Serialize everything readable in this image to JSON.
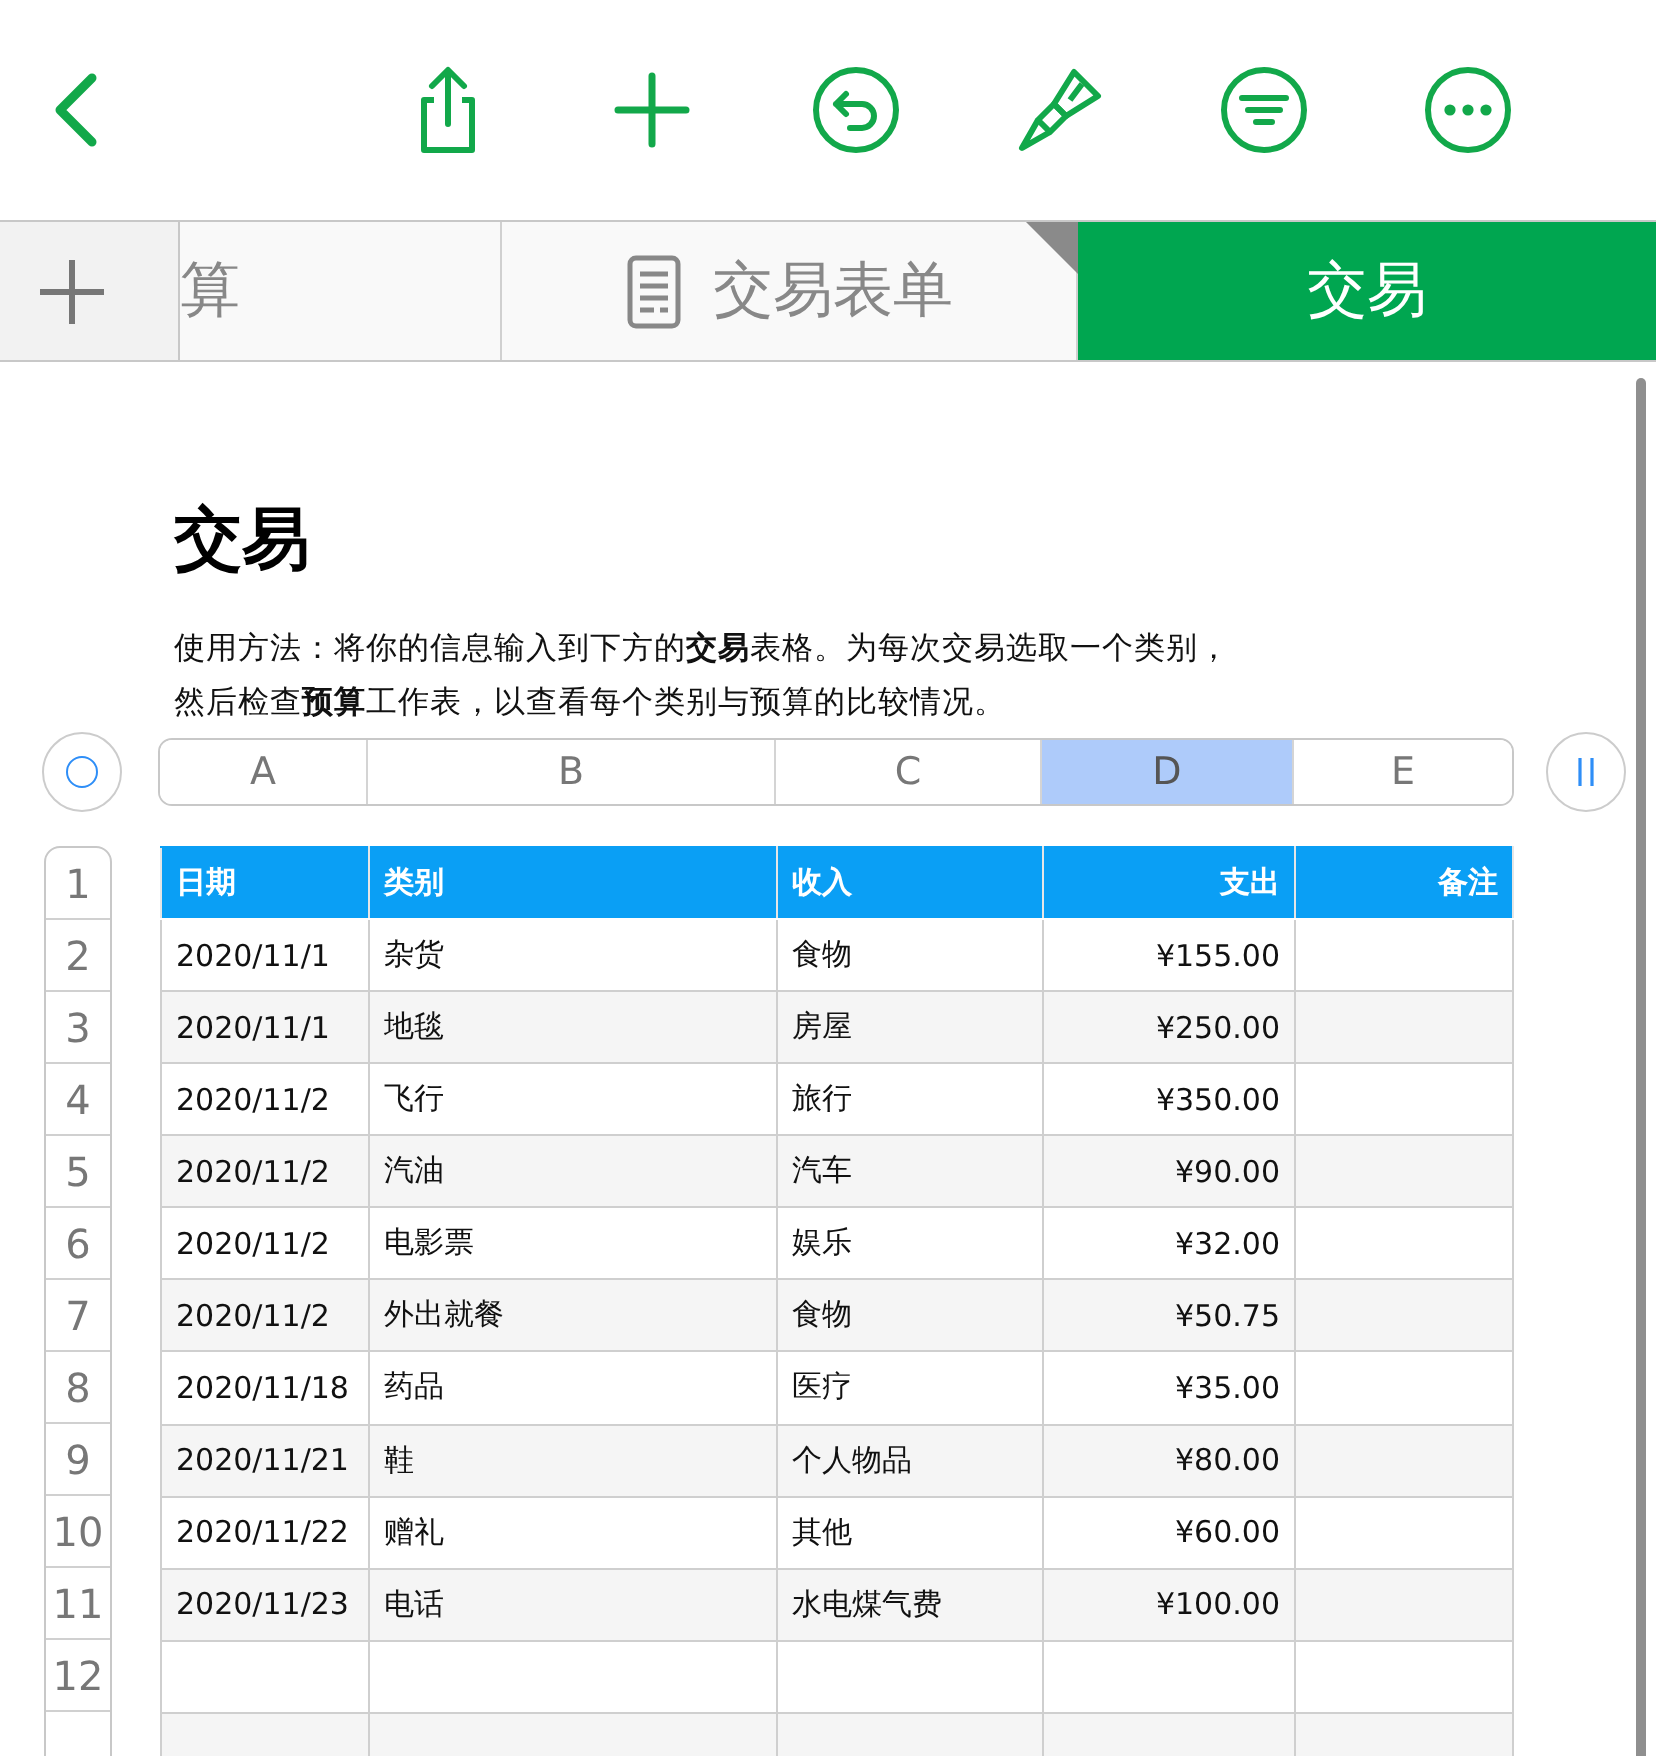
{
  "toolbar": {
    "buttons": [
      {
        "kind": "back"
      },
      {
        "kind": "share"
      },
      {
        "kind": "add"
      },
      {
        "kind": "undo"
      },
      {
        "kind": "brush"
      },
      {
        "kind": "filter"
      },
      {
        "kind": "more"
      }
    ]
  },
  "tabs": [
    {
      "label": "算",
      "icon": false,
      "selected": false
    },
    {
      "label": "交易表单",
      "icon": true,
      "selected": false
    },
    {
      "label": "交易",
      "icon": false,
      "selected": true
    }
  ],
  "sheet": {
    "title": "交易",
    "description": [
      "使用方法：将你的信息输入到下方的**交易**表格。为每次交易选取一个类别，",
      "然后检查**预算**工作表，以查看每个类别与预算的比较情况。"
    ]
  },
  "table": {
    "column_letters": [
      {
        "label": "A",
        "selected": false
      },
      {
        "label": "B",
        "selected": false
      },
      {
        "label": "C",
        "selected": false
      },
      {
        "label": "D",
        "selected": true
      },
      {
        "label": "E",
        "selected": false
      }
    ],
    "row_numbers": [
      "1",
      "2",
      "3",
      "4",
      "5",
      "6",
      "7",
      "8",
      "9",
      "10",
      "11",
      "12"
    ],
    "columns": [
      {
        "label": "日期"
      },
      {
        "label": "类别"
      },
      {
        "label": "收入"
      },
      {
        "label": "支出"
      },
      {
        "label": "备注"
      }
    ],
    "rows": [
      [
        "2020/11/1",
        "杂货",
        "食物",
        "¥155.00"
      ],
      [
        "2020/11/1",
        "地毯",
        "房屋",
        "¥250.00"
      ],
      [
        "2020/11/2",
        "飞行",
        "旅行",
        "¥350.00"
      ],
      [
        "2020/11/2",
        "汽油",
        "汽车",
        "¥90.00"
      ],
      [
        "2020/11/2",
        "电影票",
        "娱乐",
        "¥32.00"
      ],
      [
        "2020/11/2",
        "外出就餐",
        "食物",
        "¥50.75"
      ],
      [
        "2020/11/18",
        "药品",
        "医疗",
        "¥35.00"
      ],
      [
        "2020/11/21",
        "鞋",
        "个人物品",
        "¥80.00"
      ],
      [
        "2020/11/22",
        "赠礼",
        "其他",
        "¥60.00"
      ],
      [
        "2020/11/23",
        "电话",
        "水电煤气费",
        "¥100.00"
      ]
    ]
  }
}
